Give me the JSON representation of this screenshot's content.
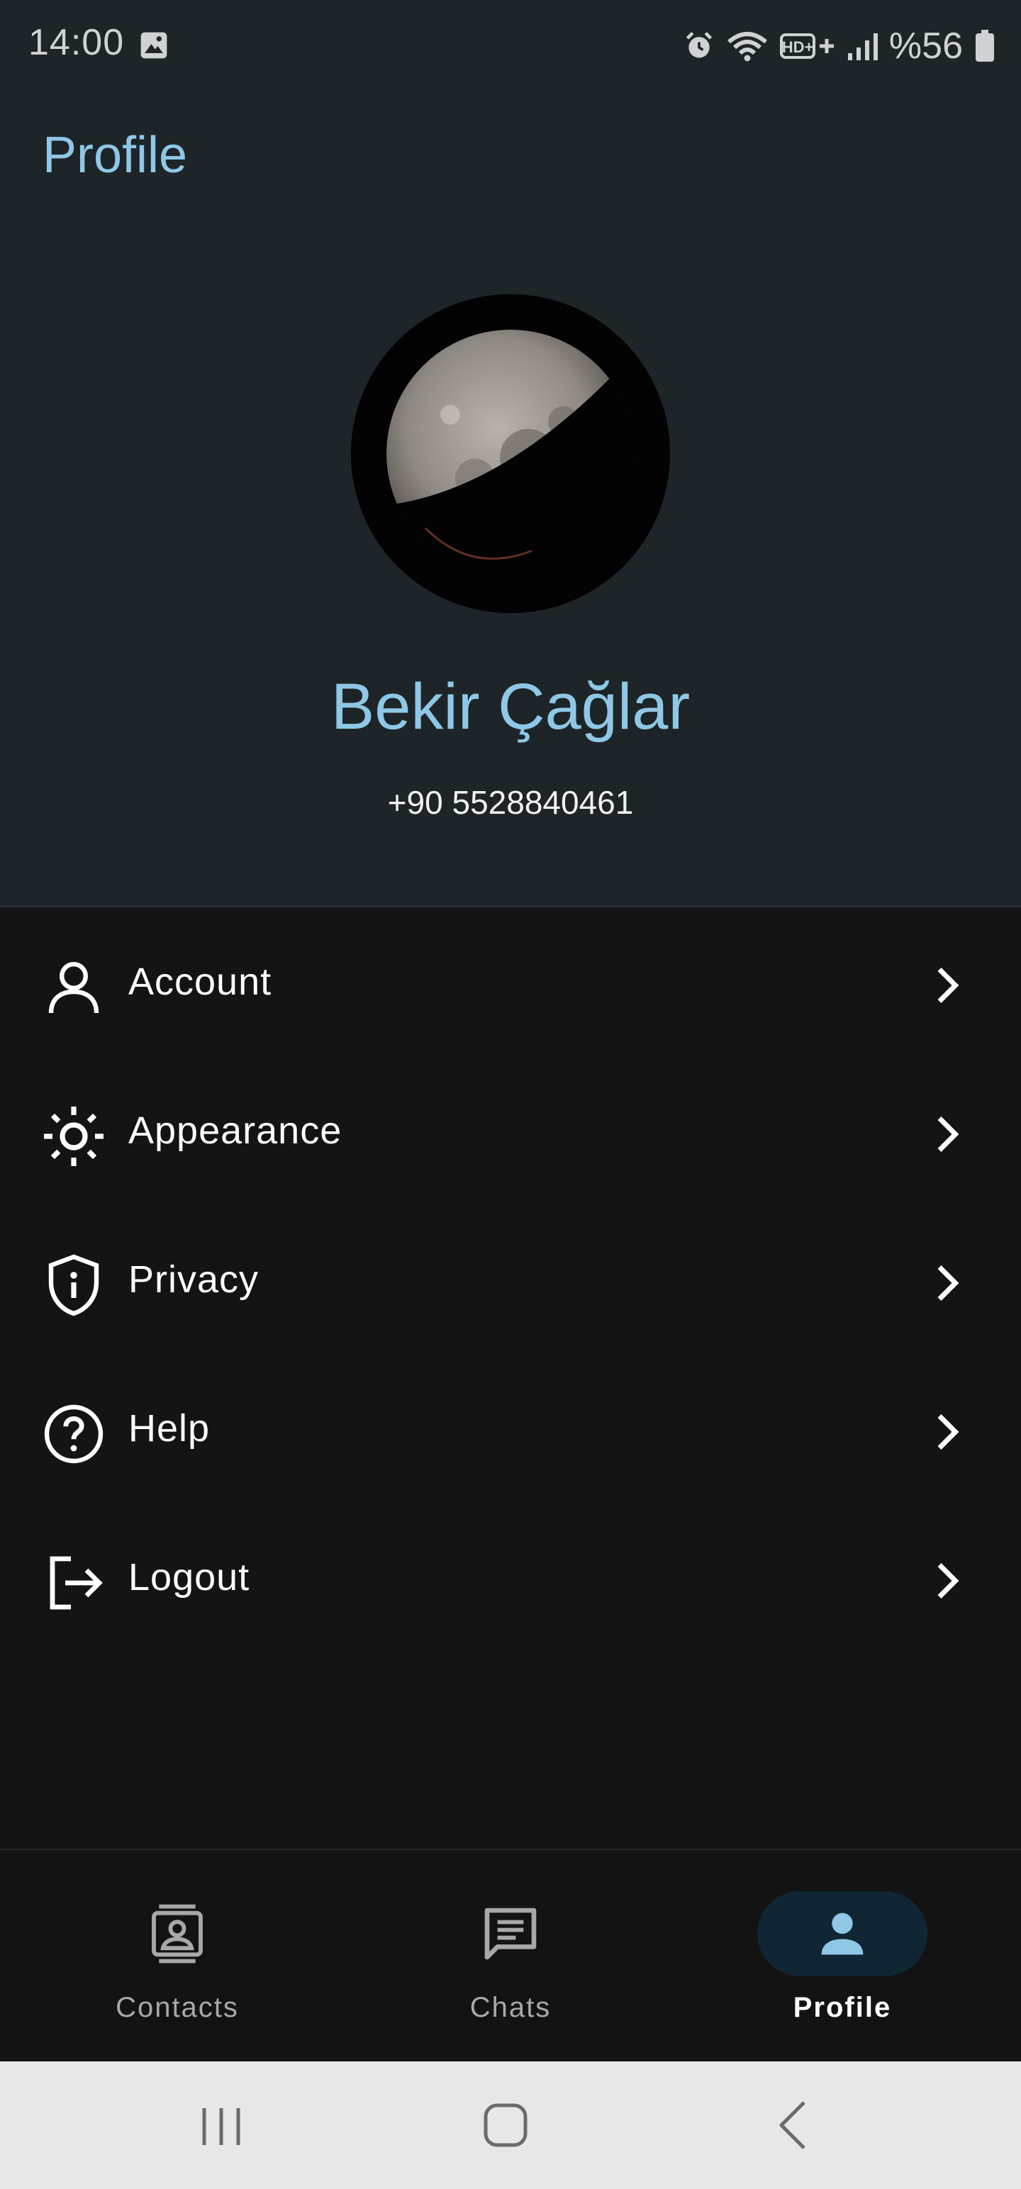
{
  "status_bar": {
    "time": "14:00",
    "battery_text": "%56",
    "network_label": "HD+"
  },
  "header": {
    "title": "Profile"
  },
  "profile": {
    "name": "Bekir Çağlar",
    "phone": "+90 5528840461"
  },
  "menu": {
    "items": [
      {
        "label": "Account",
        "icon": "person-icon"
      },
      {
        "label": "Appearance",
        "icon": "sun-icon"
      },
      {
        "label": "Privacy",
        "icon": "shield-icon"
      },
      {
        "label": "Help",
        "icon": "help-icon"
      },
      {
        "label": "Logout",
        "icon": "logout-icon"
      }
    ]
  },
  "bottom_nav": {
    "items": [
      {
        "label": "Contacts",
        "icon": "contacts-icon",
        "active": false
      },
      {
        "label": "Chats",
        "icon": "chat-icon",
        "active": false
      },
      {
        "label": "Profile",
        "icon": "person-icon",
        "active": true
      }
    ]
  },
  "colors": {
    "accent": "#8ec8e6",
    "header_bg": "#1e2528",
    "body_bg": "#141414",
    "active_nav_pill": "#102634"
  }
}
